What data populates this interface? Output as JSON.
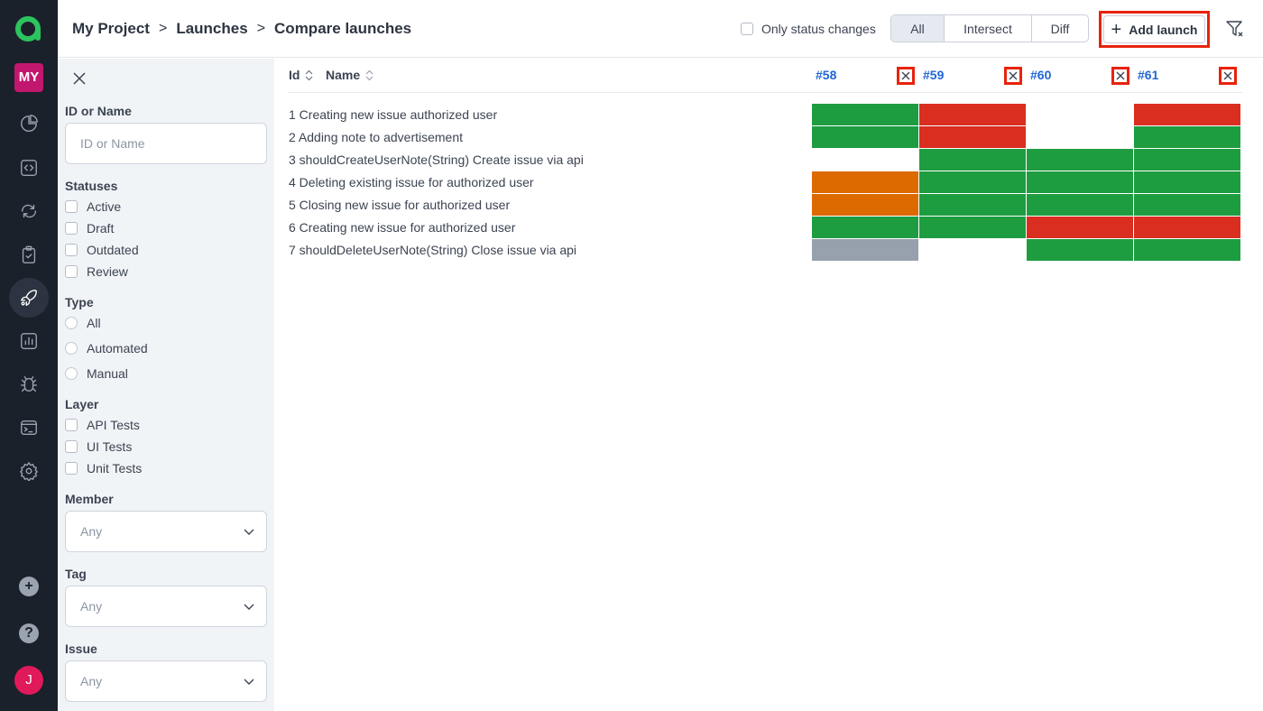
{
  "nav": {
    "project_badge": "MY",
    "user_initial": "J",
    "items": [
      {
        "icon": "dashboard-pie-icon",
        "active": false
      },
      {
        "icon": "code-icon",
        "active": false
      },
      {
        "icon": "sync-icon",
        "active": false
      },
      {
        "icon": "clipboard-check-icon",
        "active": false
      },
      {
        "icon": "rocket-icon",
        "active": true
      },
      {
        "icon": "bar-chart-icon",
        "active": false
      },
      {
        "icon": "bug-icon",
        "active": false
      },
      {
        "icon": "terminal-icon",
        "active": false
      },
      {
        "icon": "gear-icon",
        "active": false
      }
    ],
    "add_symbol": "+",
    "help_symbol": "?"
  },
  "header": {
    "breadcrumb": [
      "My Project",
      "Launches",
      "Compare launches"
    ],
    "breadcrumb_sep": ">",
    "only_status_changes": {
      "label": "Only status changes",
      "checked": false
    },
    "modes": [
      "All",
      "Intersect",
      "Diff"
    ],
    "selected_mode": "All",
    "add_launch_label": "Add launch",
    "add_launch_symbol": "+"
  },
  "filters": {
    "id_or_name": {
      "label": "ID or Name",
      "placeholder": "ID or Name",
      "value": ""
    },
    "statuses": {
      "label": "Statuses",
      "options": [
        "Active",
        "Draft",
        "Outdated",
        "Review"
      ]
    },
    "type": {
      "label": "Type",
      "options": [
        "All",
        "Automated",
        "Manual"
      ]
    },
    "layer": {
      "label": "Layer",
      "options": [
        "API Tests",
        "UI Tests",
        "Unit Tests"
      ]
    },
    "member": {
      "label": "Member",
      "value": "Any"
    },
    "tag": {
      "label": "Tag",
      "value": "Any"
    },
    "issue": {
      "label": "Issue",
      "value": "Any"
    }
  },
  "table": {
    "columns": {
      "id": "Id",
      "name": "Name"
    },
    "launches": [
      "#58",
      "#59",
      "#60",
      "#61"
    ],
    "status_colors": {
      "passed": "#1e9c40",
      "failed": "#d92e20",
      "blocked": "#dd6a00",
      "skipped": "#97a1ad",
      "none": null
    },
    "rows": [
      {
        "id": "1",
        "name": "Creating new issue authorized user",
        "results": [
          "passed",
          "failed",
          "none",
          "failed"
        ]
      },
      {
        "id": "2",
        "name": "Adding note to advertisement",
        "results": [
          "passed",
          "failed",
          "none",
          "passed"
        ]
      },
      {
        "id": "3",
        "name": "shouldCreateUserNote(String) Create issue via api",
        "results": [
          "none",
          "passed",
          "passed",
          "passed"
        ]
      },
      {
        "id": "4",
        "name": "Deleting existing issue for authorized user",
        "results": [
          "blocked",
          "passed",
          "passed",
          "passed"
        ]
      },
      {
        "id": "5",
        "name": "Closing new issue for authorized user",
        "results": [
          "blocked",
          "passed",
          "passed",
          "passed"
        ]
      },
      {
        "id": "6",
        "name": "Creating new issue for authorized user",
        "results": [
          "passed",
          "passed",
          "failed",
          "failed"
        ]
      },
      {
        "id": "7",
        "name": "shouldDeleteUserNote(String) Close issue via api",
        "results": [
          "skipped",
          "none",
          "passed",
          "passed"
        ]
      }
    ]
  }
}
